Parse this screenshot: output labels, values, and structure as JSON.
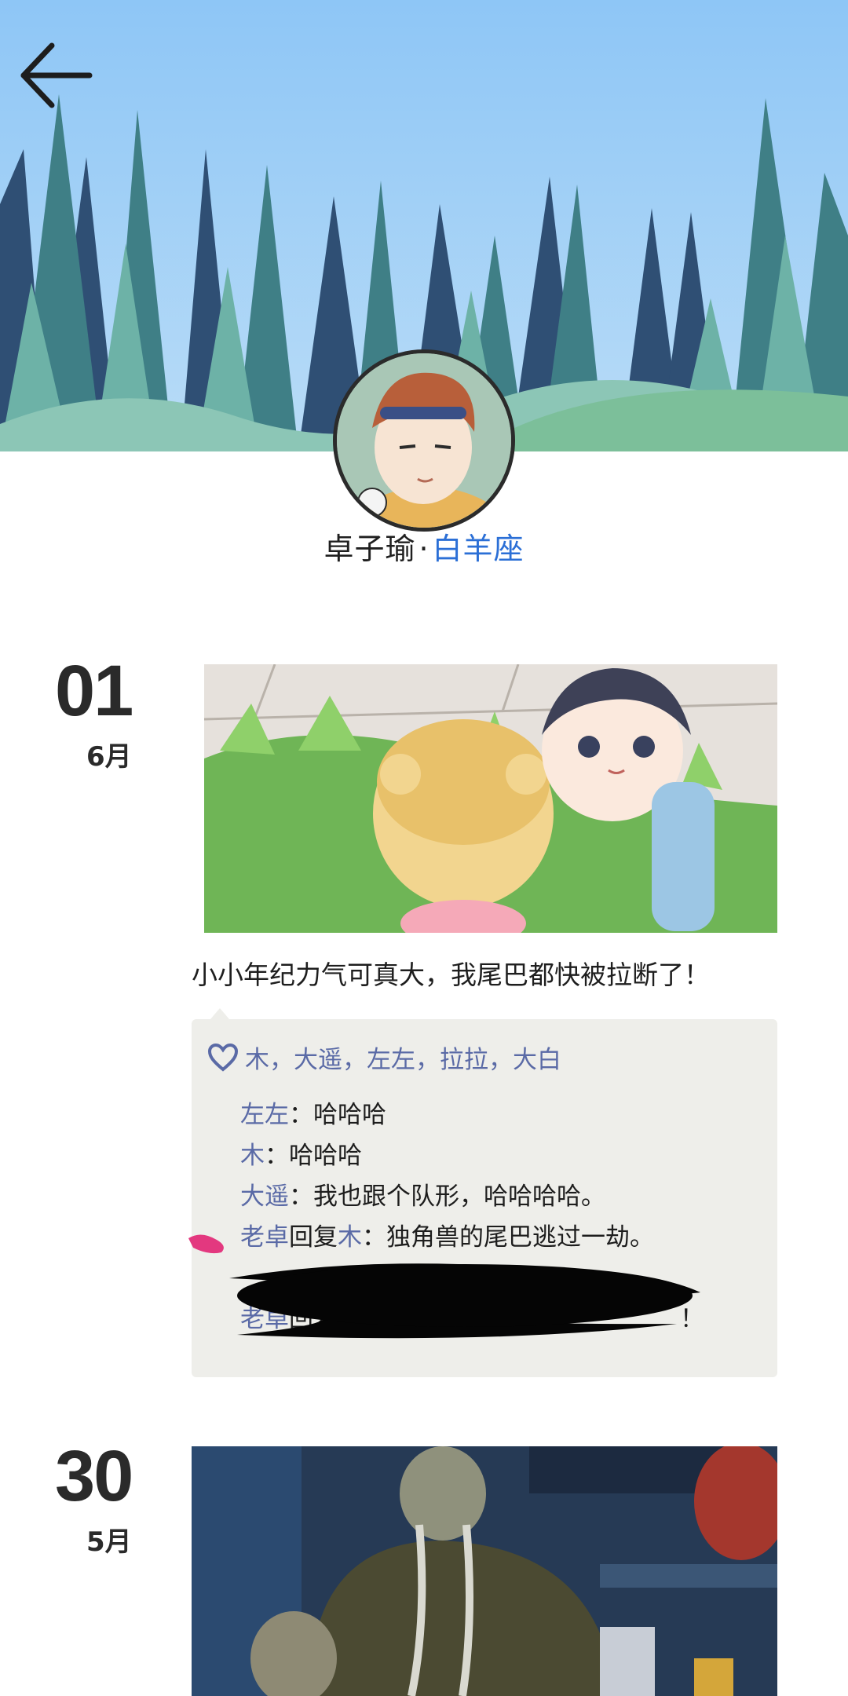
{
  "header": {
    "back_icon": "arrow-left-icon",
    "cover_image": "forest-cover"
  },
  "profile": {
    "name": "卓子瑜",
    "separator": "·",
    "sign": "白羊座"
  },
  "posts": [
    {
      "day": "01",
      "month": "6月",
      "text": "小小年纪力气可真大，我尾巴都快被拉断了！",
      "likes": "木，大遥，左左，拉拉，大白",
      "comments": [
        {
          "nick": "左左",
          "sep": "：",
          "body": "哈哈哈"
        },
        {
          "nick": "木",
          "sep": "：",
          "body": "哈哈哈"
        },
        {
          "nick": "大遥",
          "sep": "：",
          "body": "我也跟个队形，哈哈哈哈。"
        },
        {
          "nick": "老卓",
          "reply": "回复",
          "target": "木",
          "sep": "：",
          "body": "独角兽的尾巴逃过一劫。"
        },
        {
          "partial": "老卓",
          "partial_tail": "回复",
          "end": "！"
        }
      ]
    },
    {
      "day": "30",
      "month": "5月"
    }
  ],
  "colors": {
    "sky": "#8ec4f2",
    "nick": "#5a6aa6",
    "sign": "#2b6fd6",
    "comment_bg": "#eeeeea"
  }
}
